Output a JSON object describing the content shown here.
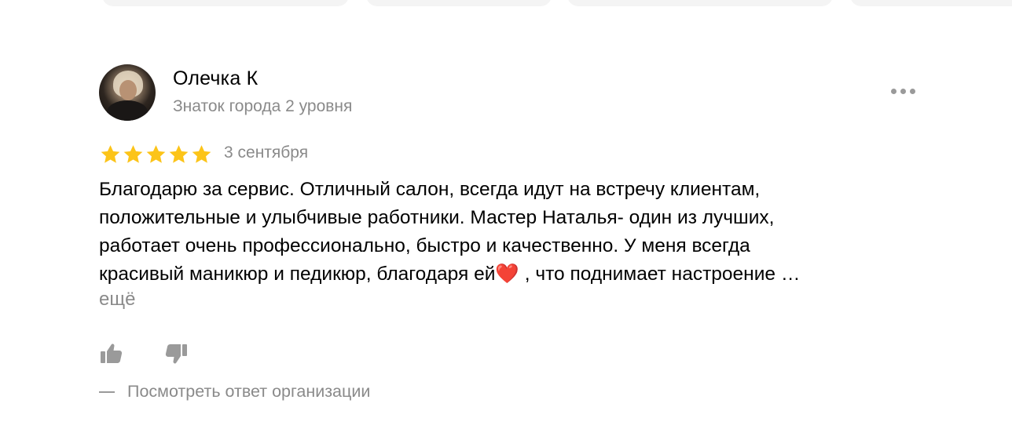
{
  "review": {
    "author": {
      "name": "Олечка К",
      "level": "Знаток города 2 уровня"
    },
    "rating": 5,
    "rating_max": 5,
    "date": "3 сентября",
    "text_lines": [
      "Благодарю за сервис. Отличный салон, всегда идут на встречу клиентам,",
      "положительные и улыбчивые работники. Мастер Наталья- один из лучших,",
      "работает очень профессионально, быстро и качественно. У меня всегда",
      "красивый маникюр и педикюр, благодаря ей"
    ],
    "text_emoji": "❤️",
    "text_last_tail": " , что поднимает настроение …",
    "more_label": "ещё",
    "org_answer_label": "Посмотреть ответ организации"
  },
  "icons": {
    "avatar": "user-photo",
    "more": "more-dots-icon",
    "star": "star-icon",
    "like": "thumbs-up-icon",
    "dislike": "thumbs-down-icon"
  },
  "colors": {
    "star": "#fcc419",
    "secondary_text": "#8a8a8a",
    "icon_gray": "#9a9a9a",
    "chip_bg": "#f4f4f4"
  }
}
